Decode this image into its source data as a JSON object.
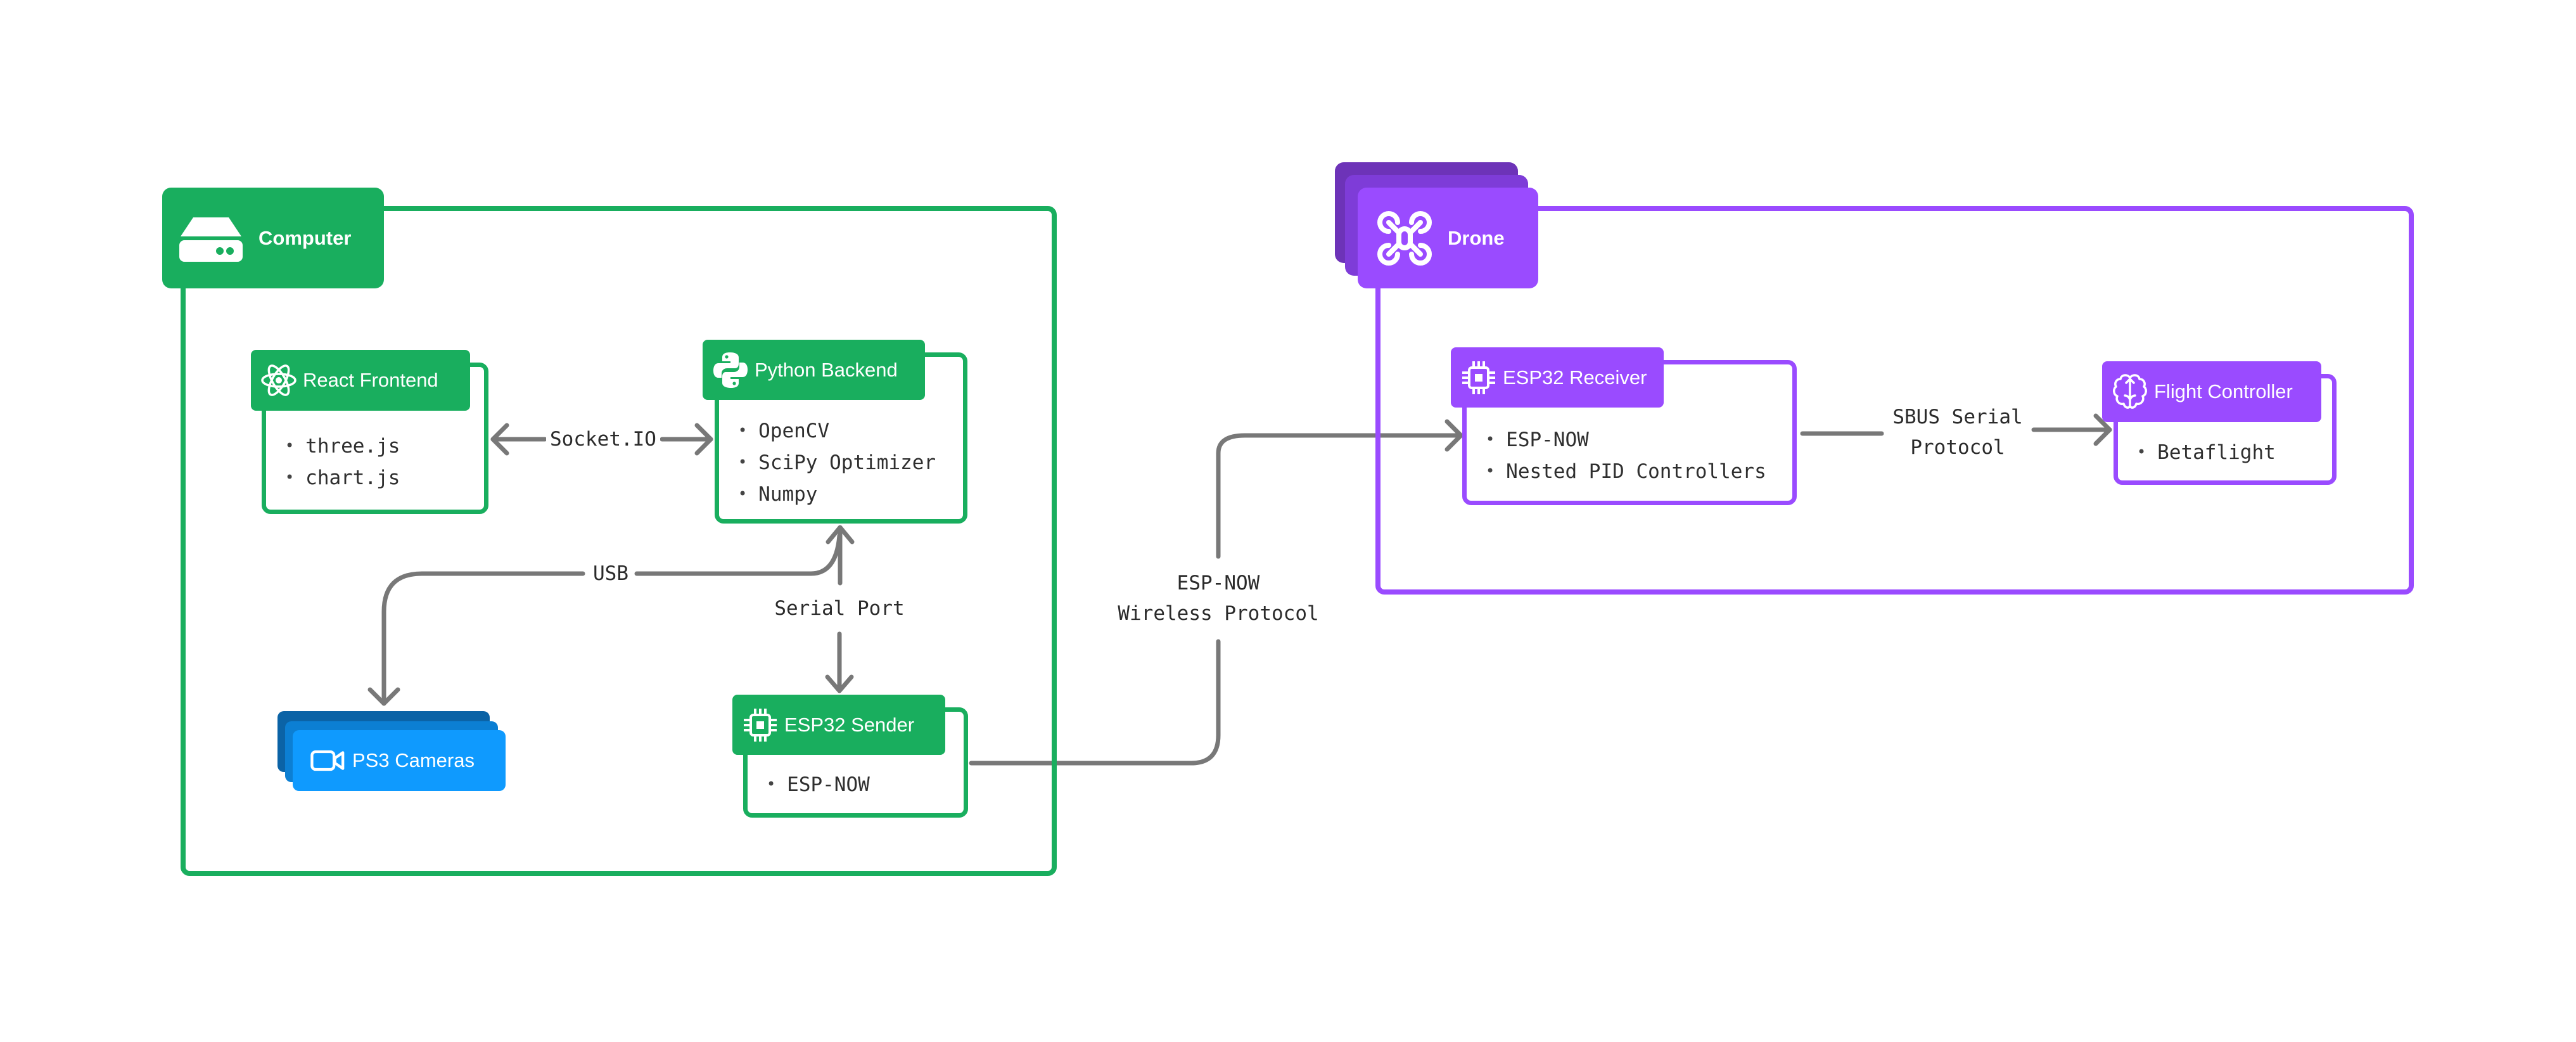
{
  "colors": {
    "computer_green": "#19AE5E",
    "drone_purple": "#9A4BFF",
    "drone_purple_mid": "#7E3CD8",
    "drone_purple_back": "#6D33B8",
    "camera_blue": "#0F9AFE",
    "camera_blue_mid": "#0C7FD3",
    "camera_blue_back": "#0B63A6",
    "wire_gray": "#787878"
  },
  "groups": {
    "computer": {
      "label": "Computer",
      "icon": "server-icon"
    },
    "drone": {
      "label": "Drone",
      "icon": "drone-icon"
    }
  },
  "nodes": {
    "react_frontend": {
      "title": "React Frontend",
      "icon": "react-atom-icon",
      "items": [
        "three.js",
        "chart.js"
      ]
    },
    "python_backend": {
      "title": "Python Backend",
      "icon": "python-icon",
      "items": [
        "OpenCV",
        "SciPy Optimizer",
        "Numpy"
      ]
    },
    "ps3_cameras": {
      "title": "PS3 Cameras",
      "icon": "video-camera-icon"
    },
    "esp32_sender": {
      "title": "ESP32 Sender",
      "icon": "chip-icon",
      "items": [
        "ESP-NOW"
      ]
    },
    "esp32_receiver": {
      "title": "ESP32 Receiver",
      "icon": "chip-icon",
      "items": [
        "ESP-NOW",
        "Nested PID Controllers"
      ]
    },
    "flight_controller": {
      "title": "Flight Controller",
      "icon": "brain-icon",
      "items": [
        "Betaflight"
      ]
    }
  },
  "edges": {
    "socketio": {
      "label": "Socket.IO",
      "from": "React Frontend",
      "to": "Python Backend",
      "direction": "bidirectional"
    },
    "usb": {
      "label": "USB",
      "from": "PS3 Cameras",
      "to": "Python Backend",
      "direction": "bidirectional"
    },
    "serial_port": {
      "label": "Serial Port",
      "from": "Python Backend",
      "to": "ESP32 Sender",
      "direction": "bidirectional"
    },
    "espnow": {
      "label_line1": "ESP-NOW",
      "label_line2": "Wireless Protocol",
      "from": "ESP32 Sender",
      "to": "ESP32 Receiver",
      "direction": "forward"
    },
    "sbus": {
      "label_line1": "SBUS Serial",
      "label_line2": "Protocol",
      "from": "ESP32 Receiver",
      "to": "Flight Controller",
      "direction": "forward"
    }
  }
}
